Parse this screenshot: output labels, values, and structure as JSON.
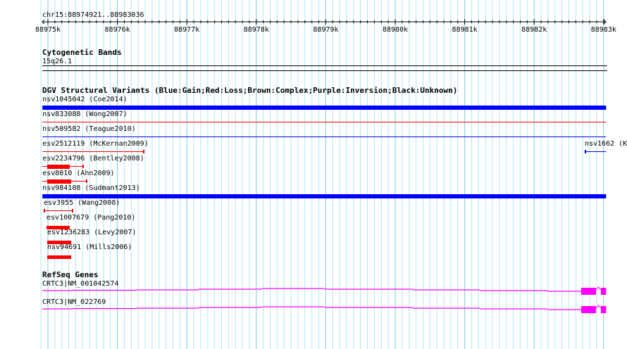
{
  "view": {
    "chrom": "chr15",
    "start": 88974921,
    "end": 88983036,
    "location_label": "chr15:88974921..88983036"
  },
  "ruler": {
    "ticks": [
      "88975k",
      "88976k",
      "88977k",
      "88978k",
      "88979k",
      "88980k",
      "88981k",
      "88982k",
      "88983k"
    ]
  },
  "colors": {
    "gain": "#0000ff",
    "loss": "#ff0000",
    "gene": "#ff00ff",
    "grid_minor": "#aee8f0",
    "grid_major": "#7ec8e8"
  },
  "tracks": {
    "cytobands": {
      "title": "Cytogenetic Bands",
      "band": "15q26.1"
    },
    "dgv": {
      "title": "DGV Structural Variants (Blue:Gain;Red:Loss;Brown:Complex;Purple:Inversion;Black:Unknown)",
      "features": [
        {
          "label": "nsv1045042 (Coe2014)",
          "type": "gain",
          "style": "thick",
          "start": 88974921,
          "end": 88983036
        },
        {
          "label": "nsv833088 (Wong2007)",
          "type": "loss",
          "style": "line",
          "start": 88974921,
          "end": 88983036
        },
        {
          "label": "nsv509582 (Teague2010)",
          "type": "gain",
          "style": "line",
          "start": 88974921,
          "end": 88983036
        },
        {
          "label": "esv2512119 (McKernan2009)",
          "type": "loss",
          "style": "capped",
          "start": 88974921,
          "end": 88976389
        },
        {
          "label": "nsv1662 (K",
          "type": "gain",
          "style": "capped",
          "start": 88982728,
          "end": 88983036,
          "same_row_as_previous": true
        },
        {
          "label": "esv2234796 (Bentley2008)",
          "type": "loss",
          "style": "capped",
          "start": 88974921,
          "end": 88975517,
          "thick_start": 88974990,
          "thick_end": 88975314
        },
        {
          "label": "esv8010 (Ahn2009)",
          "type": "loss",
          "style": "capped",
          "start": 88974921,
          "end": 88975568,
          "thick_start": 88974990,
          "thick_end": 88975335
        },
        {
          "label": "nsv984108 (Sudmant2013)",
          "type": "gain",
          "style": "thick",
          "start": 88974921,
          "end": 88983036
        },
        {
          "label": "esv3955 (Wang2008)",
          "type": "loss",
          "style": "capped",
          "start": 88974939,
          "end": 88975365
        },
        {
          "label": "esv1007679 (Pang2010)",
          "type": "loss",
          "style": "block",
          "start": 88974980,
          "end": 88975314
        },
        {
          "label": "esv1236283 (Levy2007)",
          "type": "loss",
          "style": "block",
          "start": 88974990,
          "end": 88975335
        },
        {
          "label": "nsv94691 (Mills2006)",
          "type": "loss",
          "style": "block",
          "start": 88974990,
          "end": 88975335
        }
      ]
    },
    "refseq": {
      "title": "RefSeq Genes",
      "genes": [
        {
          "label": "CRTC3|NM_001042574",
          "exons": [
            [
              88982677,
              88982890
            ],
            [
              88982961,
              88983036
            ]
          ]
        },
        {
          "label": "CRTC3|NM_022769",
          "exons": [
            [
              88982677,
              88982890
            ],
            [
              88982961,
              88983036
            ]
          ]
        }
      ]
    }
  }
}
